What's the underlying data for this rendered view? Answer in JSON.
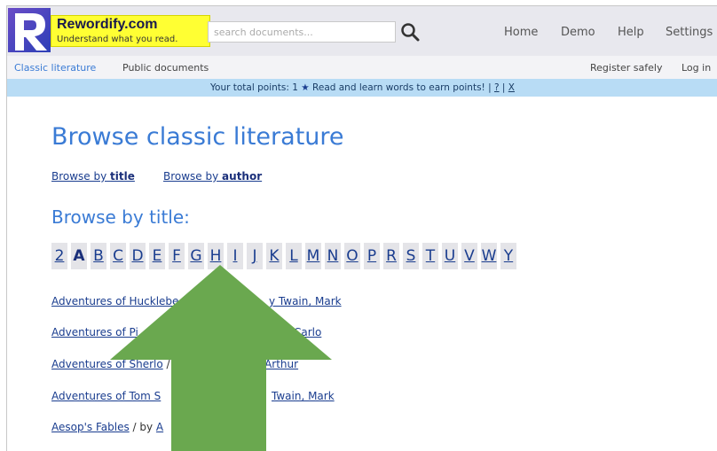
{
  "header": {
    "brand_name": "Rewordify.com",
    "brand_tagline": "Understand what you read.",
    "search_placeholder": "search documents...",
    "nav": [
      "Home",
      "Demo",
      "Help",
      "Settings"
    ]
  },
  "subnav": {
    "left": [
      "Classic literature",
      "Public documents"
    ],
    "right": [
      "Register safely",
      "Log in"
    ]
  },
  "points_bar": {
    "text_before": "Your total points: 1",
    "text_after": "Read and learn words to earn points!",
    "links": [
      "?",
      "X"
    ]
  },
  "main": {
    "title": "Browse classic literature",
    "browse_by_title_prefix": "Browse by ",
    "browse_by_title_bold": "title",
    "browse_by_author_prefix": "Browse by ",
    "browse_by_author_bold": "author",
    "section_title": "Browse by title:",
    "current_letter": "A",
    "letters": [
      "2",
      "A",
      "B",
      "C",
      "D",
      "E",
      "F",
      "G",
      "H",
      "I",
      "J",
      "K",
      "L",
      "M",
      "N",
      "O",
      "P",
      "R",
      "S",
      "T",
      "U",
      "V",
      "W",
      "Y"
    ],
    "books": [
      {
        "title": "Adventures of Hucklebe",
        "by": "",
        "author": "y Twain, Mark"
      },
      {
        "title": "Adventures of Pi",
        "by": "",
        "author": "l, Carlo"
      },
      {
        "title": "Adventures of Sherlo",
        "by": "/ by",
        "author": "Conan Doyle, Arthur"
      },
      {
        "title": "Adventures of Tom S",
        "by": "",
        "author": "Twain, Mark"
      },
      {
        "title": "Aesop's Fables",
        "by": "/ by",
        "author": "A"
      }
    ]
  },
  "colors": {
    "accent": "#3a7bd5",
    "link": "#1a3d8f",
    "brand_yellow": "#ffff33",
    "points_bar": "#b8dcf5",
    "arrow": "#6aa84f"
  },
  "icons": [
    "logo-r-icon",
    "search-icon",
    "star-icon",
    "up-arrow-icon"
  ]
}
